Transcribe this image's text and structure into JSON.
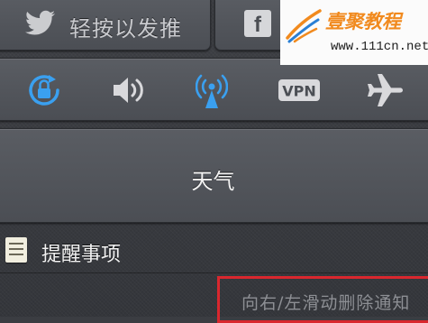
{
  "share": {
    "twitter_label": "轻按以发推",
    "twitter_icon": "twitter-bird-icon",
    "facebook_icon": "facebook-icon",
    "facebook_glyph": "f"
  },
  "toggles": [
    {
      "name": "rotation-lock",
      "icon": "rotation-lock-icon",
      "color": "#3aa0f0"
    },
    {
      "name": "sound",
      "icon": "speaker-icon",
      "color": "#d9d9dc"
    },
    {
      "name": "wifi-tower",
      "icon": "antenna-icon",
      "color": "#3aa0f0"
    },
    {
      "name": "vpn",
      "icon": "vpn-icon",
      "label": "VPN",
      "color": "#d9d9dc"
    },
    {
      "name": "airplane",
      "icon": "airplane-icon",
      "color": "#d9d9dc"
    }
  ],
  "weather": {
    "title": "天气"
  },
  "reminders": {
    "label": "提醒事项",
    "icon": "reminders-list-icon"
  },
  "hint": {
    "text": "向右/左滑动删除通知"
  },
  "watermark": {
    "brand": "壹聚教程",
    "url": "www.111cn.net"
  }
}
